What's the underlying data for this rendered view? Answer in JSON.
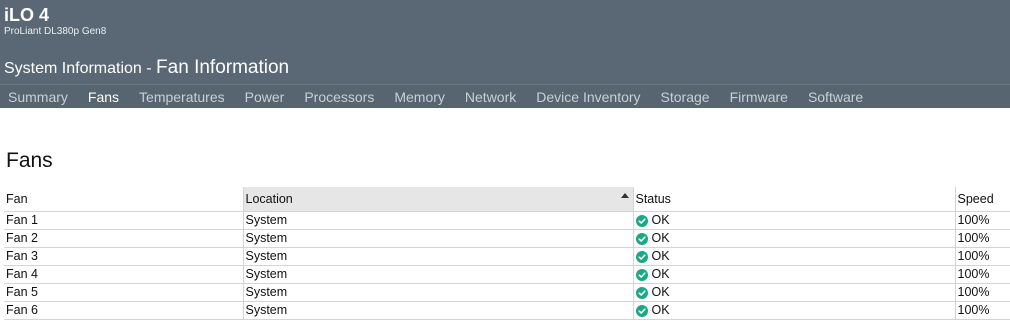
{
  "app": {
    "title": "iLO 4",
    "subtitle": "ProLiant DL380p Gen8"
  },
  "heading": {
    "section": "System Information",
    "separator": " - ",
    "page": "Fan Information"
  },
  "tabs": [
    {
      "label": "Summary",
      "active": false
    },
    {
      "label": "Fans",
      "active": true
    },
    {
      "label": "Temperatures",
      "active": false
    },
    {
      "label": "Power",
      "active": false
    },
    {
      "label": "Processors",
      "active": false
    },
    {
      "label": "Memory",
      "active": false
    },
    {
      "label": "Network",
      "active": false
    },
    {
      "label": "Device Inventory",
      "active": false
    },
    {
      "label": "Storage",
      "active": false
    },
    {
      "label": "Firmware",
      "active": false
    },
    {
      "label": "Software",
      "active": false
    }
  ],
  "fans_section": {
    "title": "Fans",
    "columns": {
      "fan": "Fan",
      "location": "Location",
      "status": "Status",
      "speed": "Speed"
    },
    "sorted_column": "location",
    "rows": [
      {
        "fan": "Fan 1",
        "location": "System",
        "status": "OK",
        "speed": "100%"
      },
      {
        "fan": "Fan 2",
        "location": "System",
        "status": "OK",
        "speed": "100%"
      },
      {
        "fan": "Fan 3",
        "location": "System",
        "status": "OK",
        "speed": "100%"
      },
      {
        "fan": "Fan 4",
        "location": "System",
        "status": "OK",
        "speed": "100%"
      },
      {
        "fan": "Fan 5",
        "location": "System",
        "status": "OK",
        "speed": "100%"
      },
      {
        "fan": "Fan 6",
        "location": "System",
        "status": "OK",
        "speed": "100%"
      }
    ]
  },
  "colors": {
    "header_bg": "#596874",
    "status_ok": "#1aa886"
  },
  "icons": {
    "status_ok": "check-circle-icon",
    "sort": "sort-ascending-icon"
  }
}
